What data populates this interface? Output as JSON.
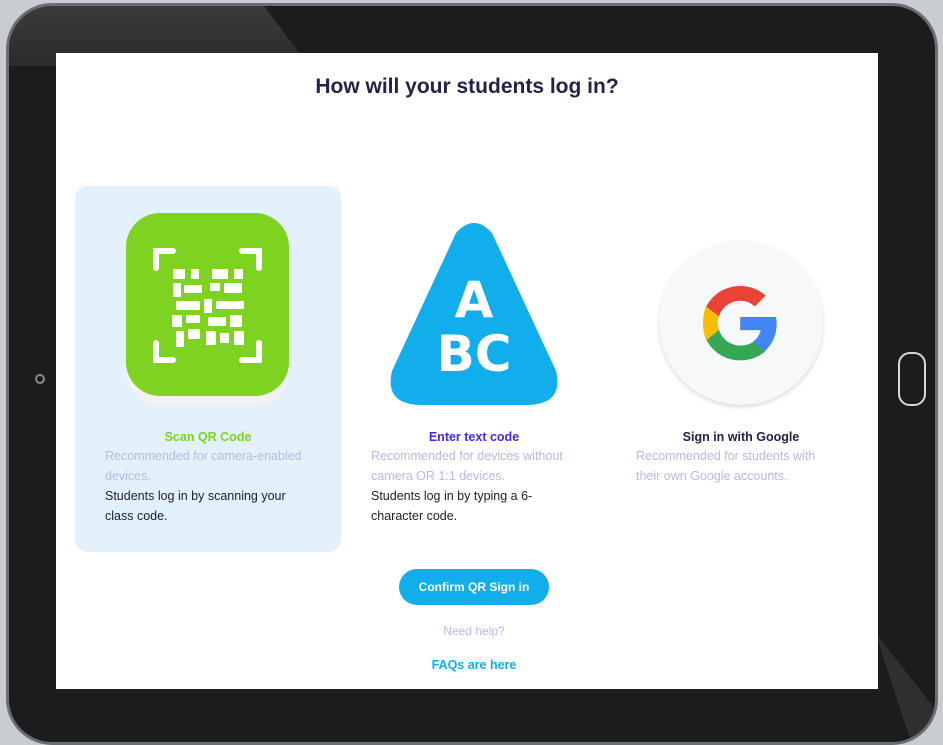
{
  "header": {
    "title": "How will your students log in?"
  },
  "options": [
    {
      "title": "Scan QR Code",
      "description": "Recommended for camera-enabled devices.",
      "body": "Students log in by scanning your class code.",
      "title_color": "#7ed321",
      "selected": true,
      "icon": "qr-code-icon"
    },
    {
      "title": "Enter text code",
      "description": "Recommended for devices without camera OR 1:1 devices.",
      "body": "Students log in by typing a 6-character code.",
      "title_color": "#4a26e6",
      "selected": false,
      "icon": "abc-triangle-icon",
      "icon_text_top": "A",
      "icon_text_bottom": "BC"
    },
    {
      "title": "Sign in with Google",
      "description": "Recommended for students with their own Google accounts.",
      "title_color": "#23234a",
      "selected": false,
      "icon": "google-icon"
    }
  ],
  "actions": {
    "confirm_label": "Confirm QR Sign in",
    "help_text": "Need help?",
    "faq_label": "FAQs are here"
  },
  "colors": {
    "accent": "#12aeec",
    "qr_green": "#7ed321",
    "selected_bg": "#e3f1fd",
    "muted_text": "#b6bbe3"
  }
}
